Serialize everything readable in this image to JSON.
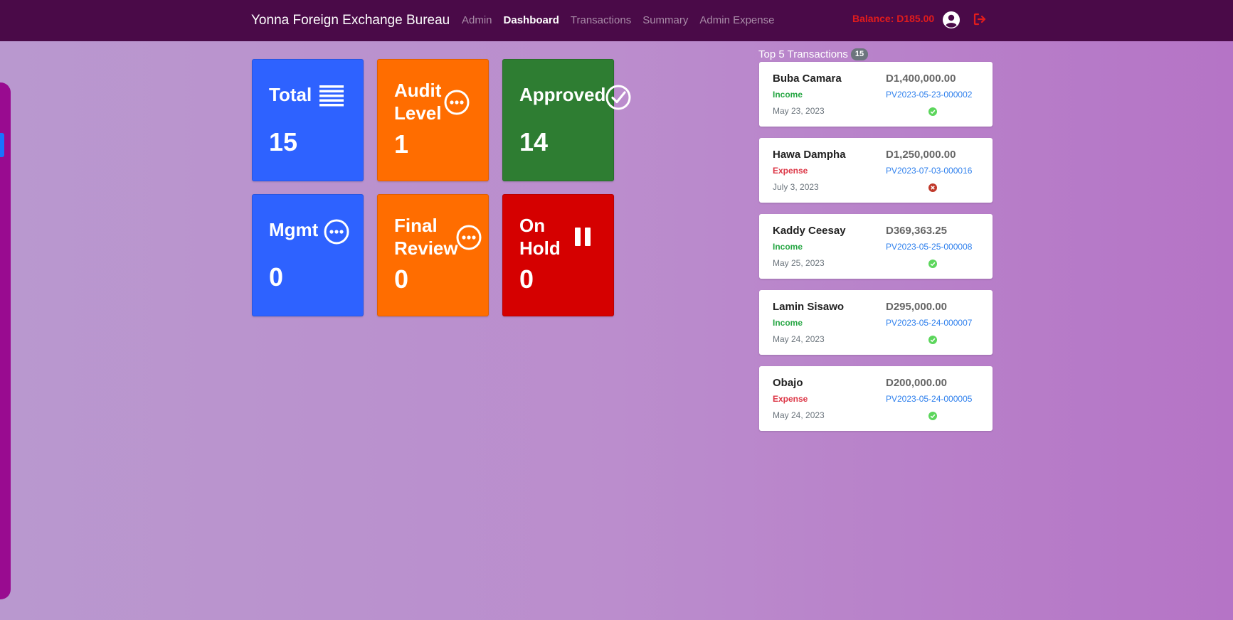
{
  "nav": {
    "brand": "Yonna Foreign Exchange Bureau",
    "links": [
      {
        "label": "Admin",
        "active": false
      },
      {
        "label": "Dashboard",
        "active": true
      },
      {
        "label": "Transactions",
        "active": false
      },
      {
        "label": "Summary",
        "active": false
      },
      {
        "label": "Admin Expense",
        "active": false
      }
    ],
    "balance": "Balance: D185.00"
  },
  "cards": [
    {
      "label_lines": [
        "Total"
      ],
      "count": "15",
      "color": "#2e62ff",
      "icon": "list-icon"
    },
    {
      "label_lines": [
        "Audit",
        "Level"
      ],
      "count": "1",
      "color": "#ff6d00",
      "icon": "more-circle-icon"
    },
    {
      "label_lines": [
        "Approved"
      ],
      "count": "14",
      "color": "#2e7d32",
      "icon": "check-circle-icon"
    },
    {
      "label_lines": [
        "Mgmt"
      ],
      "count": "0",
      "color": "#2e62ff",
      "icon": "more-circle-icon"
    },
    {
      "label_lines": [
        "Final",
        "Review"
      ],
      "count": "0",
      "color": "#ff6d00",
      "icon": "more-circle-icon"
    },
    {
      "label_lines": [
        "On",
        "Hold"
      ],
      "count": "0",
      "color": "#d50000",
      "icon": "pause-icon"
    }
  ],
  "top_transactions": {
    "title": "Top 5 Transactions",
    "count": "15",
    "items": [
      {
        "name": "Buba Camara",
        "type": "Income",
        "date": "May 23, 2023",
        "amount": "D1,400,000.00",
        "ref": "PV2023-05-23-000002",
        "status": "approved"
      },
      {
        "name": "Hawa Dampha",
        "type": "Expense",
        "date": "July 3, 2023",
        "amount": "D1,250,000.00",
        "ref": "PV2023-07-03-000016",
        "status": "rejected"
      },
      {
        "name": "Kaddy Ceesay",
        "type": "Income",
        "date": "May 25, 2023",
        "amount": "D369,363.25",
        "ref": "PV2023-05-25-000008",
        "status": "approved"
      },
      {
        "name": "Lamin Sisawo",
        "type": "Income",
        "date": "May 24, 2023",
        "amount": "D295,000.00",
        "ref": "PV2023-05-24-000007",
        "status": "approved"
      },
      {
        "name": "Obajo",
        "type": "Expense",
        "date": "May 24, 2023",
        "amount": "D200,000.00",
        "ref": "PV2023-05-24-000005",
        "status": "approved"
      }
    ]
  },
  "colors": {
    "navbar": "#4a0a48",
    "balance": "#e21c1c",
    "income": "#28a745",
    "expense": "#dc3545",
    "link": "#2f80ed",
    "approved": "#5cd65c",
    "rejected": "#c0392b"
  }
}
